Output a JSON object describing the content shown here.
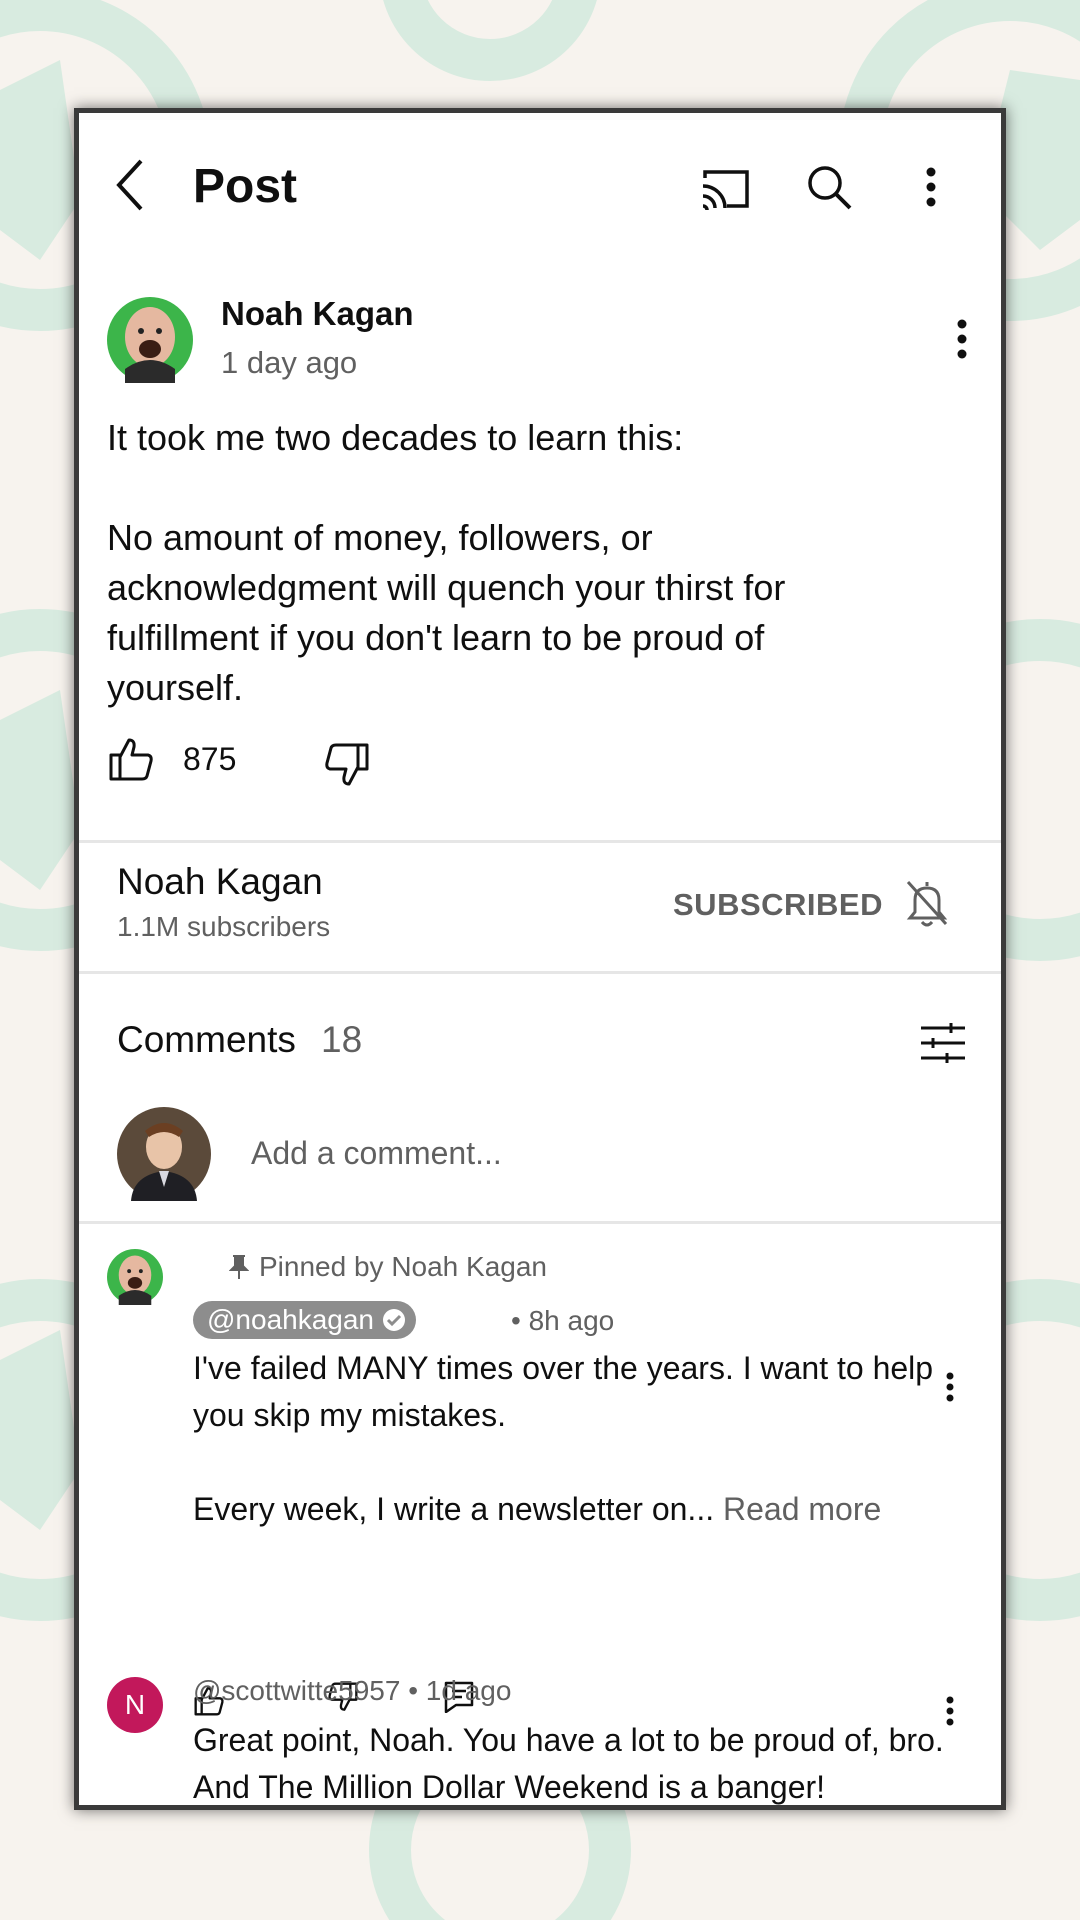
{
  "header": {
    "title": "Post"
  },
  "post": {
    "author": "Noah Kagan",
    "time": "1 day ago",
    "body": [
      "It took me two decades to learn this:",
      "No amount of money, followers, or acknowledgment will quench your thirst for fulfillment if you don't learn to be proud of yourself."
    ],
    "likes": "875"
  },
  "channel": {
    "name": "Noah Kagan",
    "subscribers": "1.1M subscribers",
    "subscribe_label": "SUBSCRIBED"
  },
  "comments": {
    "label": "Comments",
    "count": "18",
    "add_placeholder": "Add a comment...",
    "items": [
      {
        "pinned_label": "Pinned by Noah Kagan",
        "handle": "@noahkagan",
        "time": "• 8h ago",
        "text": [
          "I've failed MANY times over the years. I want to help you skip my mistakes.",
          "Every week, I write a newsletter on..."
        ],
        "read_more": "Read more"
      },
      {
        "avatar_letter": "N",
        "handle": "@scottwitte5957",
        "time": "• 1d ago",
        "text": "Great point, Noah. You have a lot to be proud of, bro. And The Million Dollar Weekend is a banger!"
      }
    ]
  },
  "icons": [
    "back-arrow-icon",
    "cast-icon",
    "search-icon",
    "more-vert-icon",
    "thumb-up-icon",
    "thumb-down-icon",
    "bell-off-icon",
    "filter-sliders-icon",
    "pin-icon",
    "verified-check-icon",
    "reply-icon"
  ],
  "colors": {
    "background": "#f7f3ee",
    "decoration": "#d8ebe0",
    "text": "#0f0f0f",
    "secondary_text": "#606060",
    "avatar_green": "#3cb54a",
    "avatar_letter_bg": "#c2185b"
  }
}
